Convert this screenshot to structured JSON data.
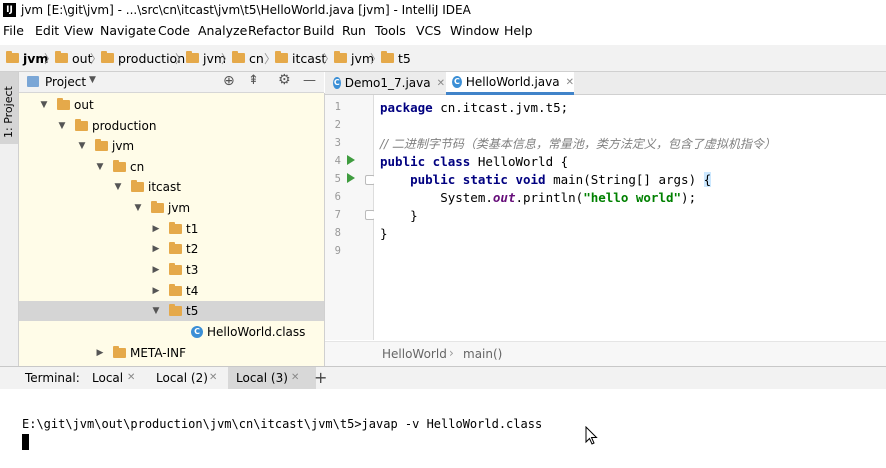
{
  "window": {
    "title": "jvm [E:\\git\\jvm] - ...\\src\\cn\\itcast\\jvm\\t5\\HelloWorld.java [jvm] - IntelliJ IDEA",
    "logo": "IJ"
  },
  "menu": [
    "File",
    "Edit",
    "View",
    "Navigate",
    "Code",
    "Analyze",
    "Refactor",
    "Build",
    "Run",
    "Tools",
    "VCS",
    "Window",
    "Help"
  ],
  "breadcrumbs": [
    "jvm",
    "out",
    "production",
    "jvm",
    "cn",
    "itcast",
    "jvm",
    "t5"
  ],
  "left_stripe": {
    "project_tab": "1: Project"
  },
  "project_panel": {
    "title": "Project",
    "tree": [
      {
        "label": "out",
        "expanded": true
      },
      {
        "label": "production",
        "expanded": true
      },
      {
        "label": "jvm",
        "expanded": true
      },
      {
        "label": "cn",
        "expanded": true
      },
      {
        "label": "itcast",
        "expanded": true
      },
      {
        "label": "jvm",
        "expanded": true
      },
      {
        "label": "t1",
        "expanded": false
      },
      {
        "label": "t2",
        "expanded": false
      },
      {
        "label": "t3",
        "expanded": false
      },
      {
        "label": "t4",
        "expanded": false
      },
      {
        "label": "t5",
        "expanded": true,
        "selected": true
      },
      {
        "label": "HelloWorld.class",
        "file": true
      },
      {
        "label": "META-INF",
        "expanded": false
      }
    ]
  },
  "editor": {
    "tabs": [
      {
        "label": "Demo1_7.java",
        "active": false
      },
      {
        "label": "HelloWorld.java",
        "active": true
      }
    ],
    "line_numbers": [
      "1",
      "2",
      "3",
      "4",
      "5",
      "6",
      "7",
      "8",
      "9"
    ],
    "code": {
      "l1_kw": "package",
      "l1_rest": " cn.itcast.jvm.t5;",
      "l3_comment": "// 二进制字节码（类基本信息，常量池，类方法定义，包含了虚拟机指令）",
      "l4_kw": "public class",
      "l4_rest": " HelloWorld {",
      "l5_indent": "    ",
      "l5_kw": "public static void",
      "l5_rest": " main(String[] args) ",
      "l5_brace": "{",
      "l6_pre": "        System.",
      "l6_field": "out",
      "l6_mid": ".println(",
      "l6_str": "\"hello world\"",
      "l6_end": ");",
      "l7": "    }",
      "l8": "}"
    },
    "breadcrumb": [
      "HelloWorld",
      "main()"
    ]
  },
  "terminal": {
    "label": "Terminal:",
    "tabs": [
      "Local",
      "Local (2)",
      "Local (3)"
    ],
    "active_tab": "Local (3)",
    "add": "+",
    "command_line": "E:\\git\\jvm\\out\\production\\jvm\\cn\\itcast\\jvm\\t5>javap -v HelloWorld.class"
  },
  "colors": {
    "folder": "#e5a94a",
    "keyword": "#000080",
    "string": "#008000",
    "comment": "#808080",
    "current_line": "#fffae3",
    "tree_bg": "#fffce8"
  },
  "icons": [
    "project-icon",
    "locate-icon",
    "collapse-icon",
    "gear-icon",
    "hide-icon",
    "folder-icon",
    "class-icon",
    "run-icon"
  ]
}
